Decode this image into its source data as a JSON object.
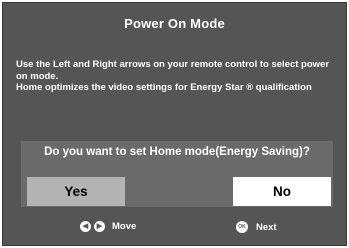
{
  "window": {
    "title": "Power On Mode"
  },
  "description": {
    "line1": "Use the Left and Right arrows on your remote control to select power on mode.",
    "line2": "Home optimizes the video settings for Energy Star ® qualification"
  },
  "dialog": {
    "question": "Do you want to set Home mode(Energy Saving)?",
    "yes_label": "Yes",
    "no_label": "No",
    "selected": "No"
  },
  "hints": {
    "move_label": "Move",
    "next_label": "Next",
    "left_icon": "left-arrow-button-icon",
    "right_icon": "right-arrow-button-icon",
    "ok_icon": "ok-button-icon"
  },
  "colors": {
    "background": "#555555",
    "dialog_background": "#6a6a6a",
    "yes_button": "#b3b3b3",
    "no_button_selected": "#ffffff",
    "text": "#ffffff"
  }
}
